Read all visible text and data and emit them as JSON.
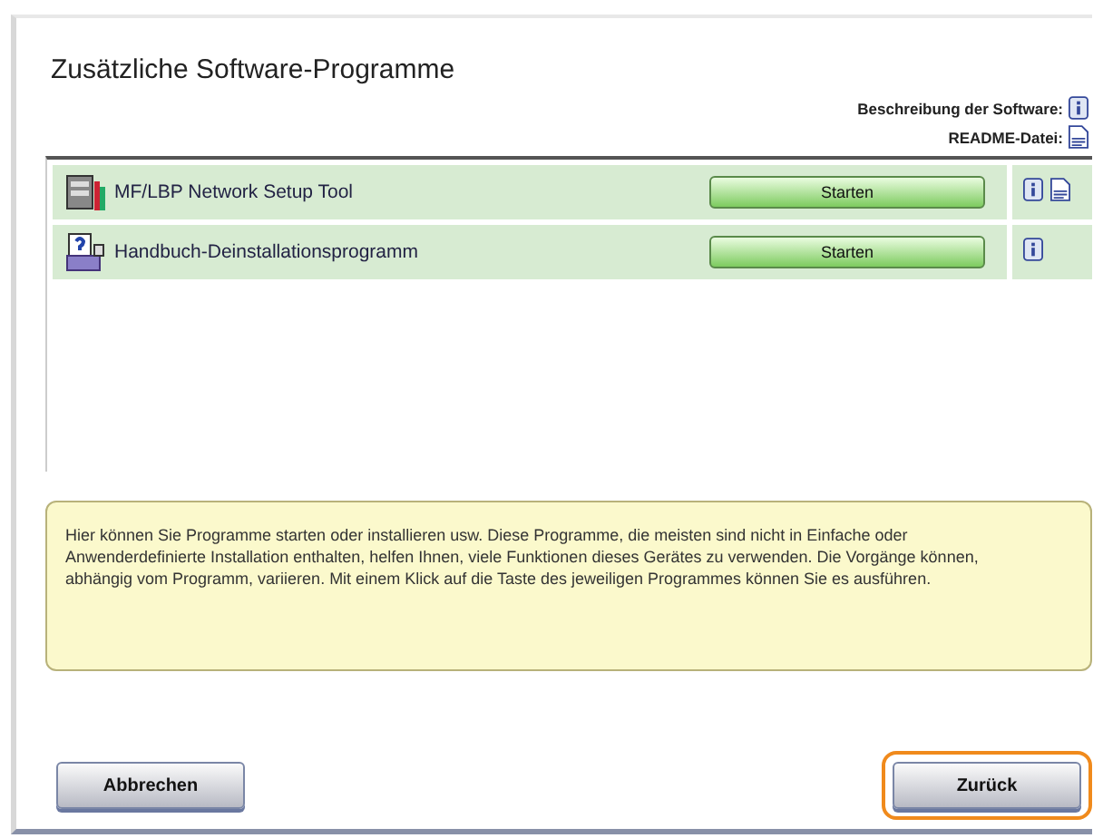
{
  "title": "Zusätzliche Software-Programme",
  "legend": [
    {
      "label": "Beschreibung der Software:",
      "kind": "info"
    },
    {
      "label": "README-Datei:",
      "kind": "readme"
    }
  ],
  "programs": [
    {
      "name": "MF/LBP Network Setup Tool",
      "kind": "network",
      "button": "Starten",
      "info": true,
      "readme": true
    },
    {
      "name": "Handbuch-Deinstallationsprogramm",
      "kind": "manual",
      "button": "Starten",
      "info": true,
      "readme": false
    }
  ],
  "description": "Hier können Sie Programme starten oder installieren usw. Diese Programme, die meisten sind nicht in Einfache oder Anwenderdefinierte Installation enthalten, helfen Ihnen, viele Funktionen dieses Gerätes zu verwenden. Die Vorgänge können, abhängig vom Programm, variieren. Mit einem Klick auf die Taste des jeweiligen Programmes können Sie es ausführen.",
  "buttons": [
    {
      "label": "Abbrechen",
      "highlighted": false
    },
    {
      "label": "Zurück",
      "highlighted": true
    }
  ]
}
